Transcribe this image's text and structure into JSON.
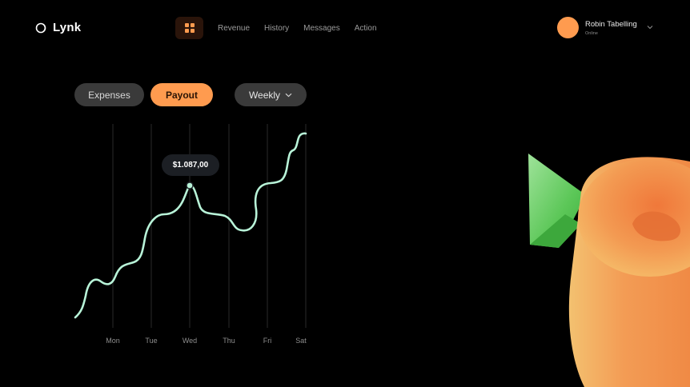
{
  "app": {
    "logo_text": "Lynk"
  },
  "nav": {
    "links": [
      "Revenue",
      "History",
      "Messages",
      "Action"
    ]
  },
  "user": {
    "name": "Robin Tabelling",
    "status": "Online"
  },
  "filters": {
    "expenses_label": "Expenses",
    "payout_label": "Payout",
    "period_label": "Weekly"
  },
  "colors": {
    "accent": "#ff9b4f",
    "line": "#b8f3d8",
    "gridline": "#2a2a2a"
  },
  "chart_data": {
    "type": "line",
    "categories": [
      "Mon",
      "Tue",
      "Wed",
      "Thu",
      "Fri",
      "Sat"
    ],
    "tooltip": {
      "category": "Wed",
      "value_label": "$1.087,00"
    }
  }
}
